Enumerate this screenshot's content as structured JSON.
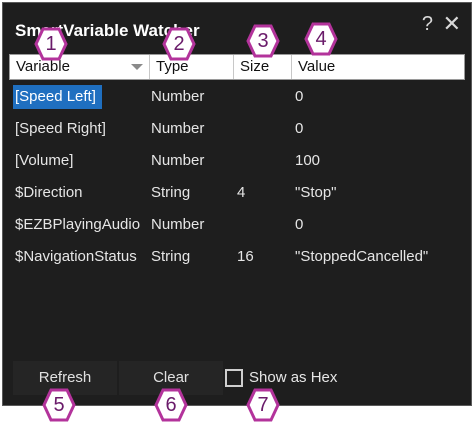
{
  "window": {
    "title": "SmartVariable Watcher",
    "help_label": "?",
    "close_label": "✕"
  },
  "columns": [
    {
      "label": "Variable"
    },
    {
      "label": "Type"
    },
    {
      "label": "Size"
    },
    {
      "label": "Value"
    }
  ],
  "rows": [
    {
      "variable": "[Speed Left]",
      "type": "Number",
      "size": "",
      "value": "0",
      "selected": true
    },
    {
      "variable": "[Speed Right]",
      "type": "Number",
      "size": "",
      "value": "0"
    },
    {
      "variable": "[Volume]",
      "type": "Number",
      "size": "",
      "value": "100"
    },
    {
      "variable": "$Direction",
      "type": "String",
      "size": "4",
      "value": "\"Stop\""
    },
    {
      "variable": "$EZBPlayingAudio",
      "type": "Number",
      "size": "",
      "value": "0"
    },
    {
      "variable": "$NavigationStatus",
      "type": "String",
      "size": "16",
      "value": "\"StoppedCancelled\""
    }
  ],
  "buttons": {
    "refresh": "Refresh",
    "clear": "Clear"
  },
  "show_as_hex": {
    "label": "Show as Hex",
    "checked": false
  },
  "callouts": [
    "1",
    "2",
    "3",
    "4",
    "5",
    "6",
    "7"
  ],
  "colors": {
    "callout_stroke": "#b3339b",
    "callout_fill": "#ffffff",
    "selection": "#1f6fc0",
    "window_bg": "#1e1e1e"
  }
}
